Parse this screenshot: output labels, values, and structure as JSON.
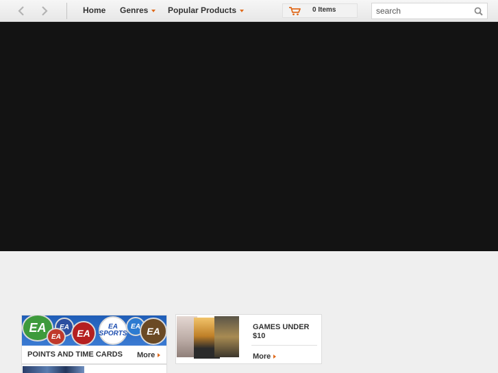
{
  "nav": {
    "back_icon": "chevron-left-icon",
    "forward_icon": "chevron-right-icon",
    "menu": [
      {
        "label": "Home",
        "has_dropdown": false
      },
      {
        "label": "Genres",
        "has_dropdown": true
      },
      {
        "label": "Popular Products",
        "has_dropdown": true
      }
    ],
    "cart_label": "0 Items",
    "search_placeholder": "search"
  },
  "promos": {
    "points": {
      "title": "POINTS AND TIME CARDS",
      "more": "More",
      "badges": [
        "EA",
        "EA",
        "EA",
        "EA",
        "EA SPORTS",
        "EA",
        "EA"
      ]
    },
    "games": {
      "title_line1": "GAMES UNDER",
      "title_line2": "$10",
      "more": "More"
    }
  },
  "colors": {
    "accent": "#e06a1b",
    "hero_bg": "#131313",
    "page_bg": "#efefef",
    "ea_blue": "#1f5db7"
  }
}
